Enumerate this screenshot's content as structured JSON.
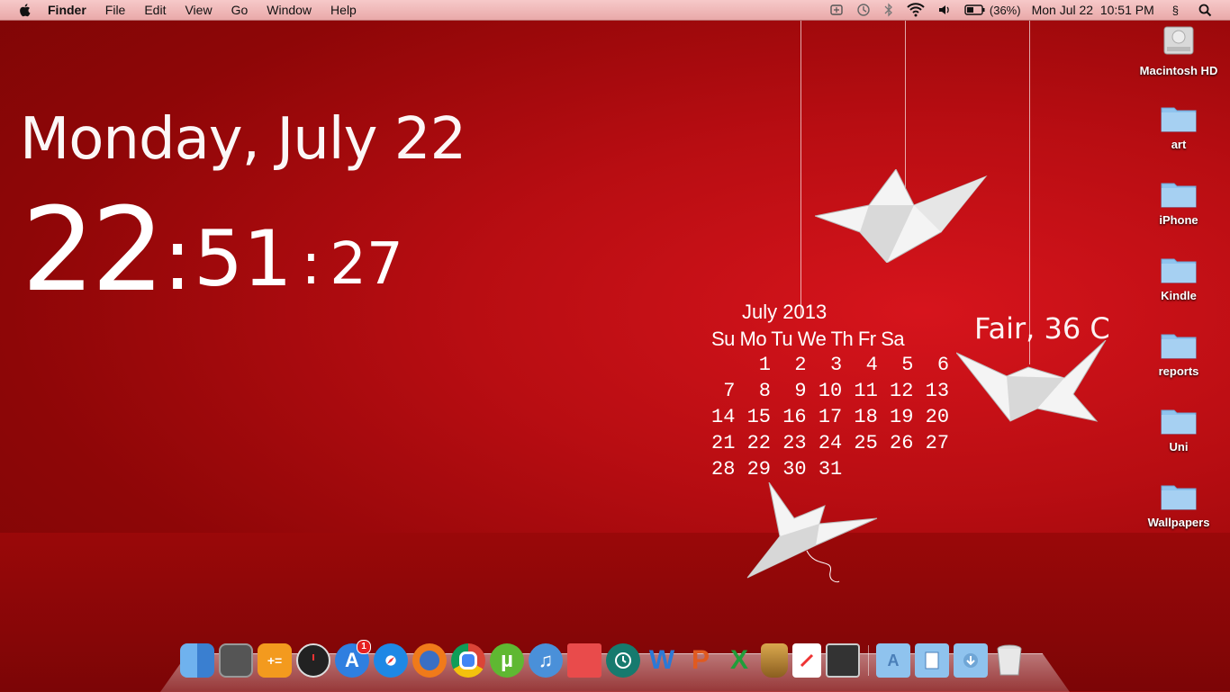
{
  "menubar": {
    "app_name": "Finder",
    "menus": [
      "File",
      "Edit",
      "View",
      "Go",
      "Window",
      "Help"
    ],
    "battery": "(36%)",
    "datetime": "Mon Jul 22  10:51 PM",
    "extra": "§"
  },
  "clock": {
    "date": "Monday, July 22",
    "hours": "22",
    "minutes": "51",
    "seconds": "27",
    "separator": ":"
  },
  "calendar": {
    "title": "July 2013",
    "weekdays": "Su Mo Tu We Th Fr Sa",
    "weeks": [
      "    1  2  3  4  5  6",
      " 7  8  9 10 11 12 13",
      "14 15 16 17 18 19 20",
      "21 22 23 24 25 26 27",
      "28 29 30 31"
    ]
  },
  "weather": {
    "text": "Fair, 36 C"
  },
  "desktop_icons": [
    {
      "label": "Macintosh HD",
      "kind": "drive"
    },
    {
      "label": "art",
      "kind": "folder"
    },
    {
      "label": "iPhone",
      "kind": "folder"
    },
    {
      "label": "Kindle",
      "kind": "folder"
    },
    {
      "label": "reports",
      "kind": "folder"
    },
    {
      "label": "Uni",
      "kind": "folder"
    },
    {
      "label": "Wallpapers",
      "kind": "folder"
    }
  ],
  "dock": {
    "app_store_badge": "1",
    "apps": [
      {
        "name": "finder-app",
        "color": "#3b82d6"
      },
      {
        "name": "photo-booth-app",
        "color": "#555555"
      },
      {
        "name": "calculator-app",
        "color": "#f39a1e"
      },
      {
        "name": "dashboard-app",
        "color": "#222222"
      },
      {
        "name": "app-store-app",
        "color": "#2f7fe0"
      },
      {
        "name": "safari-app",
        "color": "#1e88e5"
      },
      {
        "name": "firefox-app",
        "color": "#f07a1a"
      },
      {
        "name": "chrome-app",
        "color": "#e8e8e8"
      },
      {
        "name": "utorrent-app",
        "color": "#5fb832"
      },
      {
        "name": "itunes-app",
        "color": "#4a90d9"
      },
      {
        "name": "photo-slideshow-app",
        "color": "#e94b4b"
      },
      {
        "name": "time-machine-app",
        "color": "#167a6e"
      },
      {
        "name": "word-app",
        "color": "#2b79d6"
      },
      {
        "name": "powerpoint-app",
        "color": "#e05a20"
      },
      {
        "name": "excel-app",
        "color": "#1f9e3a"
      },
      {
        "name": "bucket-app",
        "color": "#b8862f"
      },
      {
        "name": "sketch-app",
        "color": "#ffffff"
      },
      {
        "name": "screen-capture-app",
        "color": "#333333"
      }
    ],
    "stacks": [
      "applications-stack",
      "documents-stack",
      "downloads-stack"
    ]
  },
  "colors": {
    "wallpaper": "#b80d12",
    "menubar": "#f1bcbc",
    "folder": "#8fc3ee"
  }
}
